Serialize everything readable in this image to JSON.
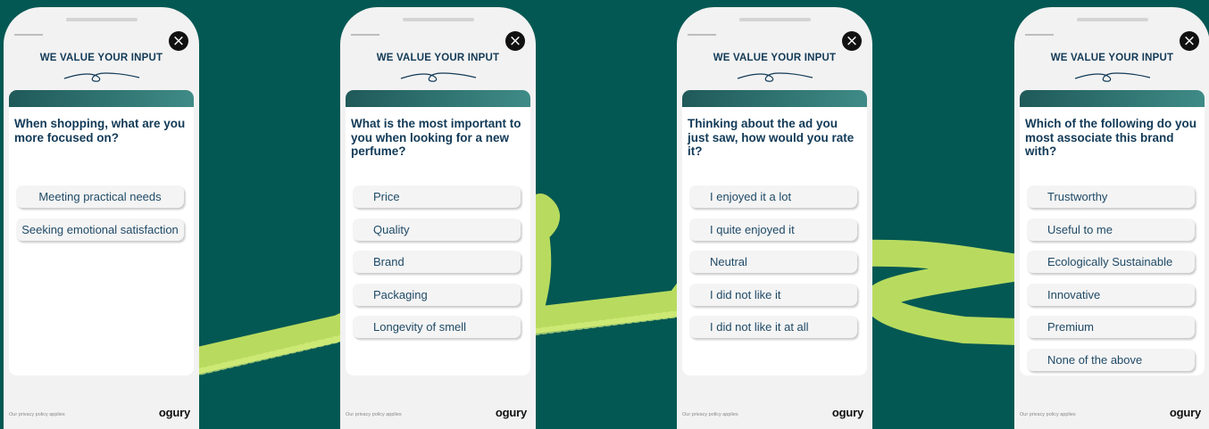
{
  "colors": {
    "background": "#045853",
    "accent_stroke": "#c2e360",
    "question_text": "#123a57",
    "band": "#2b706e"
  },
  "phones": [
    {
      "title": "WE VALUE YOUR INPUT",
      "question": "When shopping, what are you more focused on?",
      "options": [
        "Meeting practical needs",
        "Seeking emotional satisfaction"
      ],
      "privacy": "Our privacy policy applies",
      "logo": "ogury",
      "close_icon": "close-icon"
    },
    {
      "title": "WE VALUE YOUR INPUT",
      "question": "What is the most important to you when looking for a new perfume?",
      "options": [
        "Price",
        "Quality",
        "Brand",
        "Packaging",
        "Longevity of smell"
      ],
      "privacy": "Our privacy policy applies",
      "logo": "ogury",
      "close_icon": "close-icon"
    },
    {
      "title": "WE VALUE YOUR INPUT",
      "question": "Thinking about the ad you just saw, how would you rate it?",
      "options": [
        "I enjoyed it a lot",
        "I quite enjoyed it",
        "Neutral",
        "I did not like it",
        "I did not like it at all"
      ],
      "privacy": "Our privacy policy applies",
      "logo": "ogury",
      "close_icon": "close-icon"
    },
    {
      "title": "WE VALUE YOUR INPUT",
      "question": "Which of the following do you most associate this brand with?",
      "options": [
        "Trustworthy",
        "Useful to me",
        "Ecologically Sustainable",
        "Innovative",
        "Premium",
        "None of the above"
      ],
      "privacy": "Our privacy policy applies",
      "logo": "ogury",
      "close_icon": "close-icon"
    }
  ]
}
